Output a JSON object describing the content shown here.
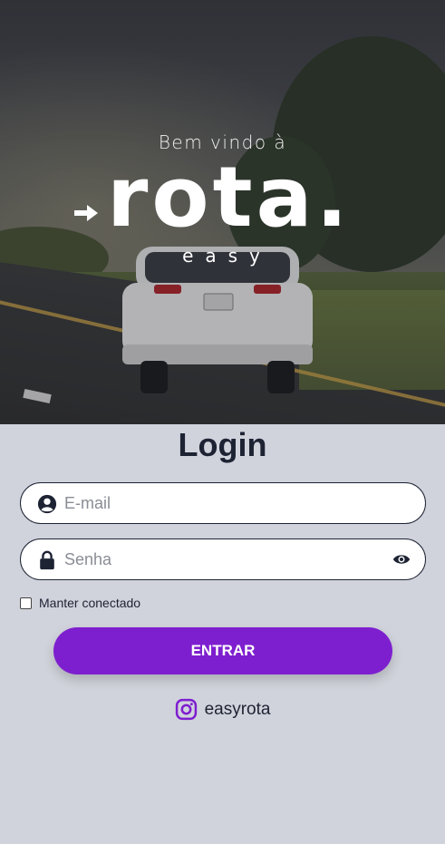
{
  "hero": {
    "welcome": "Bem vindo à",
    "logo_word": "rota.",
    "logo_sub": "easy"
  },
  "login": {
    "title": "Login",
    "email": {
      "placeholder": "E-mail",
      "value": ""
    },
    "password": {
      "placeholder": "Senha",
      "value": ""
    },
    "remember_label": "Manter conectado",
    "remember_checked": false,
    "submit_label": "ENTRAR"
  },
  "social": {
    "instagram_handle": "easyrota"
  },
  "colors": {
    "primary": "#7e1fcf",
    "text_dark": "#1d2333",
    "background": "#d1d3dc"
  }
}
